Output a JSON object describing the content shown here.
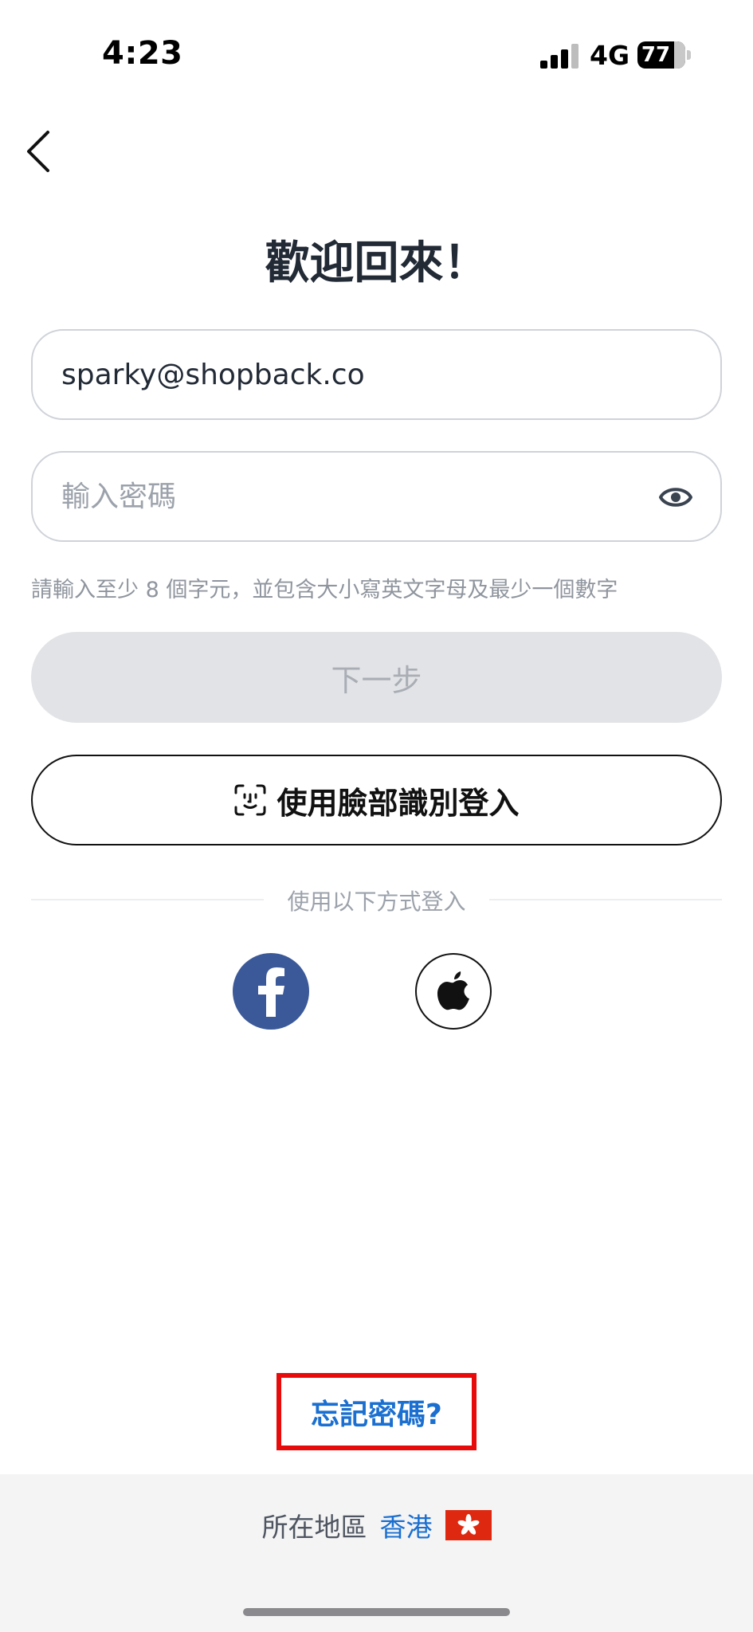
{
  "status_bar": {
    "time": "4:23",
    "network": "4G",
    "battery": "77"
  },
  "page": {
    "title": "歡迎回來！"
  },
  "form": {
    "email_value": "sparky@shopback.co",
    "password_placeholder": "輸入密碼",
    "password_hint": "請輸入至少 8 個字元，並包含大小寫英文字母及最少一個數字",
    "next_label": "下一步",
    "face_login_label": "使用臉部識別登入"
  },
  "social": {
    "divider_label": "使用以下方式登入"
  },
  "forgot": {
    "label": "忘記密碼?"
  },
  "footer": {
    "region_label": "所在地區",
    "region_value": "香港"
  },
  "colors": {
    "accent": "#1a6fd0",
    "facebook": "#3b5998",
    "highlight": "#e80b0b",
    "disabled_button": "#e2e3e6"
  }
}
